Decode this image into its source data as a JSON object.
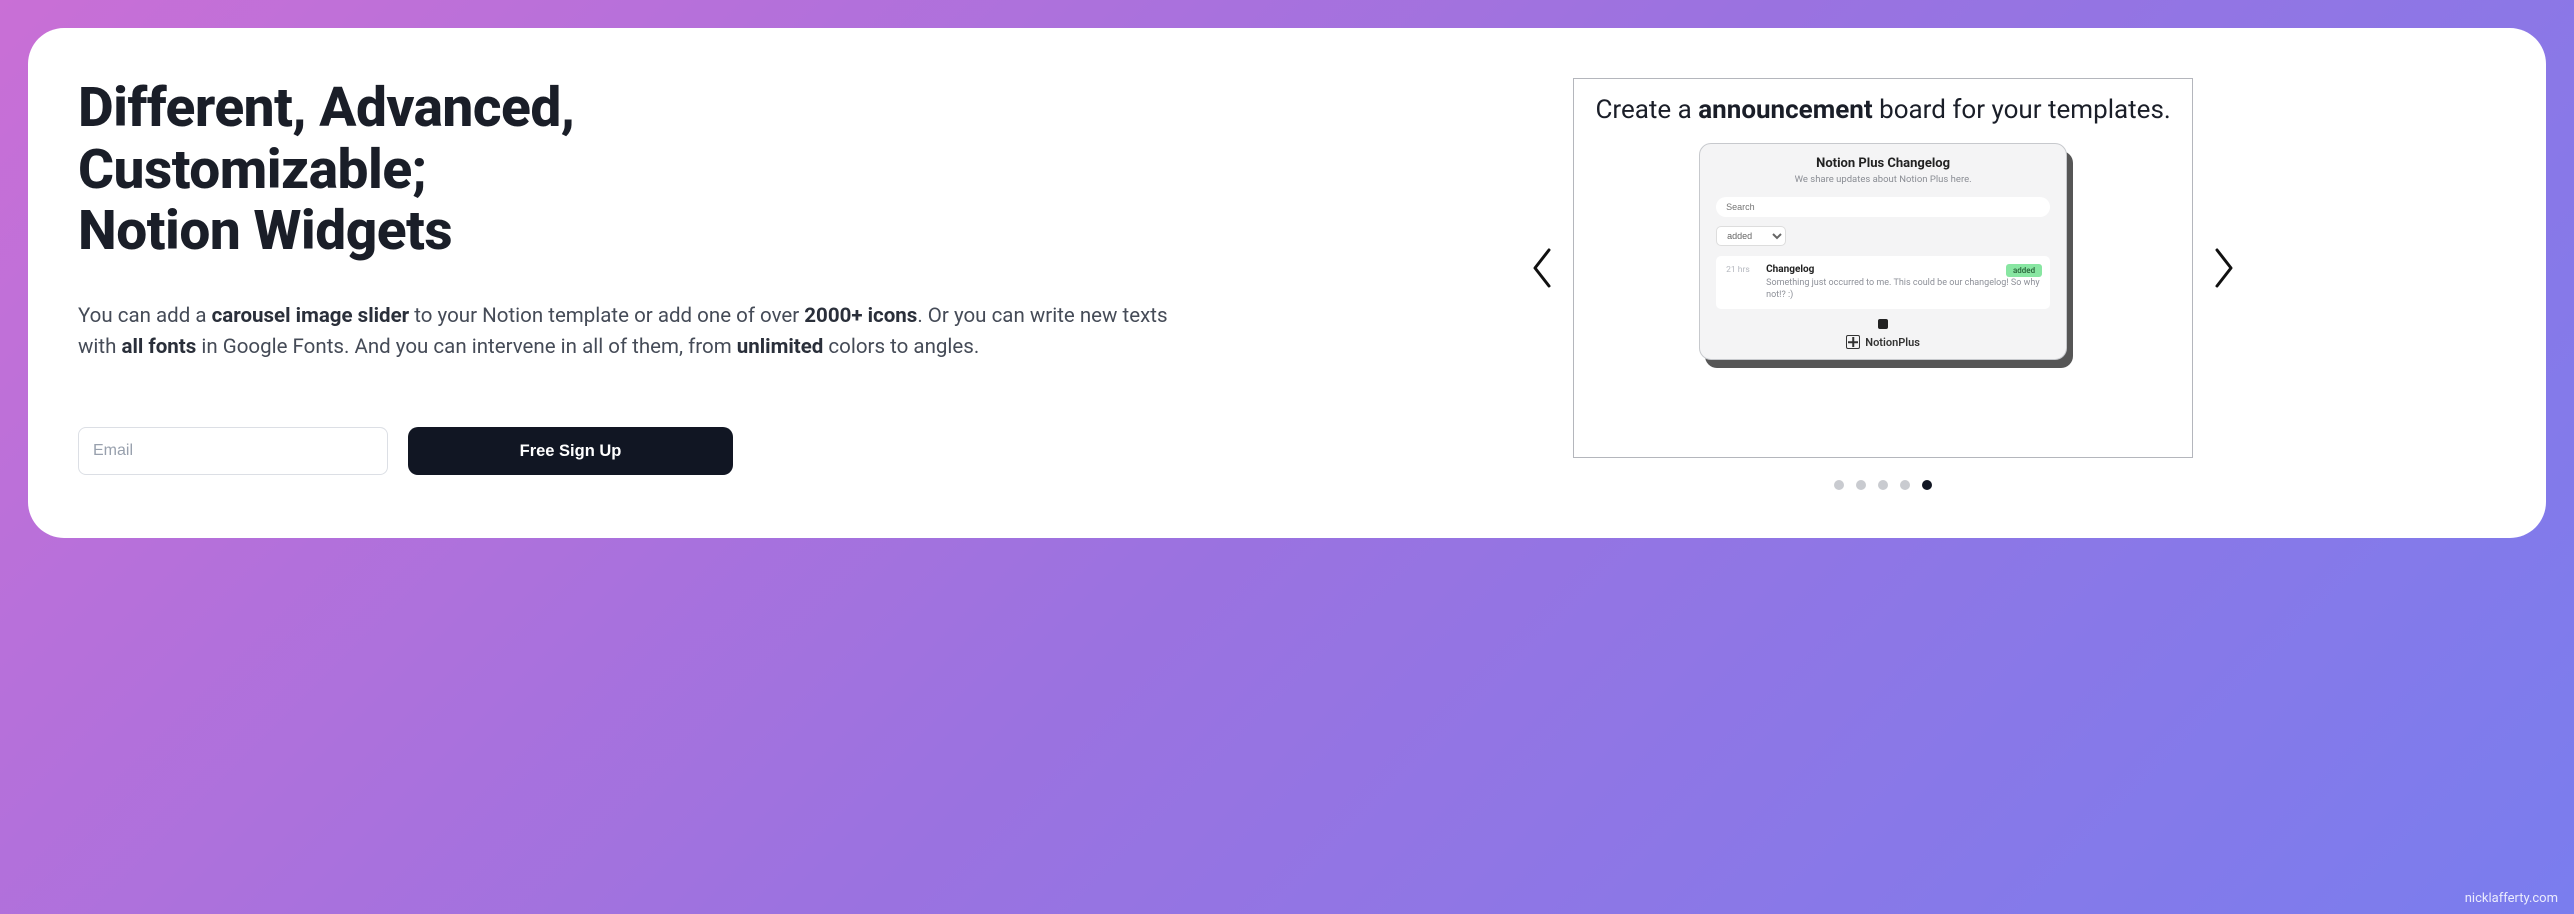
{
  "hero": {
    "title_line1": "Different, Advanced,",
    "title_line2": "Customizable;",
    "title_line3": "Notion Widgets",
    "desc_part1": "You can add a ",
    "desc_bold1": "carousel image slider",
    "desc_part2": " to your Notion template or add one of over ",
    "desc_bold2": "2000+ icons",
    "desc_part3": ". Or you can write new texts with ",
    "desc_bold3": "all fonts",
    "desc_part4": " in Google Fonts. And you can intervene in all of them, from ",
    "desc_bold4": "unlimited",
    "desc_part5": " colors to angles."
  },
  "signup": {
    "email_placeholder": "Email",
    "button_label": "Free Sign Up"
  },
  "carousel": {
    "slide_title_pre": "Create a ",
    "slide_title_bold": "announcement",
    "slide_title_post": " board for your templates.",
    "widget": {
      "title": "Notion Plus Changelog",
      "subtitle": "We share updates about Notion Plus here.",
      "search_placeholder": "Search",
      "select_label": "added",
      "entry_time": "21 hrs",
      "entry_title": "Changelog",
      "entry_text": "Something just occurred to me. This could be our changelog! So why not!? :)",
      "entry_tag": "added",
      "brand": "NotionPlus"
    },
    "total_dots": 5,
    "active_dot": 5
  },
  "watermark": "nicklafferty.com"
}
